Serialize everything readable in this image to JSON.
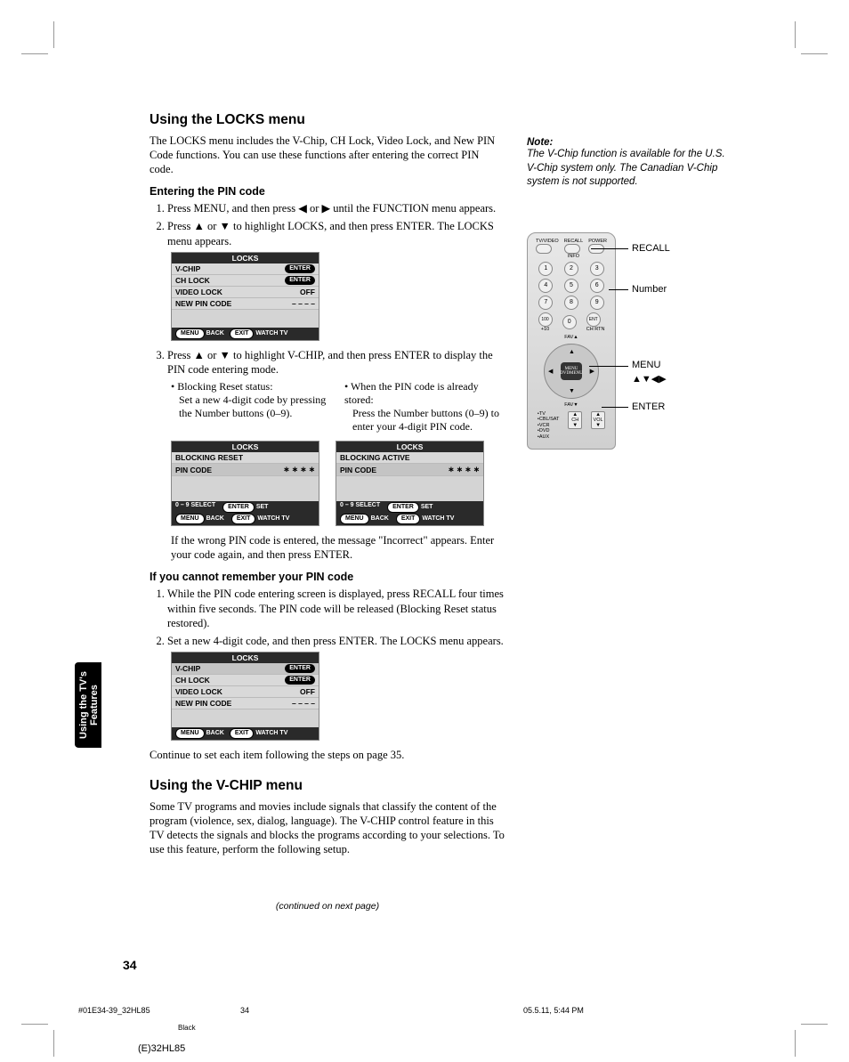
{
  "section1": {
    "title": "Using the LOCKS menu",
    "intro": "The LOCKS menu includes the V-Chip, CH Lock, Video Lock, and New PIN Code functions. You can use these functions after entering the correct PIN code."
  },
  "sub_pin": {
    "title": "Entering the PIN code",
    "step1": "Press MENU, and then press ◀ or ▶ until the FUNCTION menu appears.",
    "step2": "Press ▲ or ▼ to highlight LOCKS, and then press ENTER. The LOCKS menu appears.",
    "step3": "Press ▲ or ▼ to highlight V-CHIP, and then press ENTER to display the PIN code entering mode.",
    "bullet_left_head": "Blocking Reset status:",
    "bullet_left_body": "Set a new 4-digit code by pressing the Number buttons (0–9).",
    "bullet_right_head": "When the PIN code is already stored:",
    "bullet_right_body": "Press the Number buttons (0–9) to enter your 4-digit PIN code.",
    "wrong_pin": "If the wrong PIN code is entered, the message \"Incorrect\" appears. Enter your code again, and then press ENTER."
  },
  "osd1": {
    "title": "LOCKS",
    "r1_label": "V-CHIP",
    "r1_val": "ENTER",
    "r2_label": "CH LOCK",
    "r2_val": "ENTER",
    "r3_label": "VIDEO LOCK",
    "r3_val": "OFF",
    "r4_label": "NEW PIN CODE",
    "r4_val": "– – – –",
    "f1": "MENU",
    "f1b": "BACK",
    "f2": "EXIT",
    "f2b": "WATCH TV"
  },
  "osdA": {
    "title": "LOCKS",
    "r1": "BLOCKING RESET",
    "r2": "PIN CODE",
    "r2v": "∗ ∗ ∗ ∗",
    "fa1": "0 – 9  SELECT",
    "fa2": "ENTER",
    "fa2b": "SET",
    "fa3": "MENU",
    "fa3b": "BACK",
    "fa4": "EXIT",
    "fa4b": "WATCH TV"
  },
  "osdB": {
    "title": "LOCKS",
    "r1": "BLOCKING ACTIVE",
    "r2": "PIN CODE",
    "r2v": "∗ ∗ ∗ ∗",
    "fa1": "0 – 9  SELECT",
    "fa2": "ENTER",
    "fa2b": "SET",
    "fa3": "MENU",
    "fa3b": "BACK",
    "fa4": "EXIT",
    "fa4b": "WATCH TV"
  },
  "sub_forgot": {
    "title": "If you cannot remember your PIN code",
    "step1": "While the PIN code entering screen is displayed, press RECALL four times within five seconds. The PIN code will be released (Blocking Reset status restored).",
    "step2": "Set a new 4-digit code, and then press ENTER. The LOCKS menu appears."
  },
  "osd2": {
    "title": "LOCKS",
    "r1_label": "V-CHIP",
    "r1_val": "ENTER",
    "r2_label": "CH LOCK",
    "r2_val": "ENTER",
    "r3_label": "VIDEO LOCK",
    "r3_val": "OFF",
    "r4_label": "NEW PIN CODE",
    "r4_val": "– – – –",
    "f1": "MENU",
    "f1b": "BACK",
    "f2": "EXIT",
    "f2b": "WATCH TV"
  },
  "continue_text": "Continue to set each item following the steps on page 35.",
  "section2": {
    "title": "Using the V-CHIP menu",
    "body": "Some TV programs and movies include signals that classify the content of the program (violence, sex, dialog, language). The V-CHIP control feature in this TV detects the signals and blocks the programs according to your selections. To use this feature, perform the following setup."
  },
  "note": {
    "head": "Note:",
    "body": "The V-Chip function is available for the U.S. V-Chip system only. The Canadian V-Chip system is not supported."
  },
  "remote": {
    "top_labels": {
      "a": "TV/VIDEO",
      "b": "RECALL",
      "c": "POWER",
      "info": "INFO"
    },
    "nums": [
      "1",
      "2",
      "3",
      "4",
      "5",
      "6",
      "7",
      "8",
      "9",
      "100",
      "0",
      "ENT"
    ],
    "sub_labels": {
      "a": "+10",
      "b": "",
      "c": "CH RTN"
    },
    "fav_up": "FAV▲",
    "fav_dn": "FAV▼",
    "center": "MENU\nDVDMENU",
    "ch": "CH",
    "vol": "VOL",
    "side_labels": [
      "•TV",
      "•CBL/SAT",
      "•VCR",
      "•DVD",
      "•AUX"
    ],
    "callouts": {
      "recall": "RECALL",
      "number": "Number",
      "menu": "MENU",
      "arrows": "▲▼◀▶",
      "enter": "ENTER"
    }
  },
  "sidetab": "Using the TV's\nFeatures",
  "cont": "(continued on next page)",
  "pagenum": "34",
  "foot_left": "#01E34-39_32HL85",
  "foot_mid": "34",
  "foot_right": "05.5.11, 5:44 PM",
  "foot_black": "Black",
  "foot_model": "(E)32HL85"
}
